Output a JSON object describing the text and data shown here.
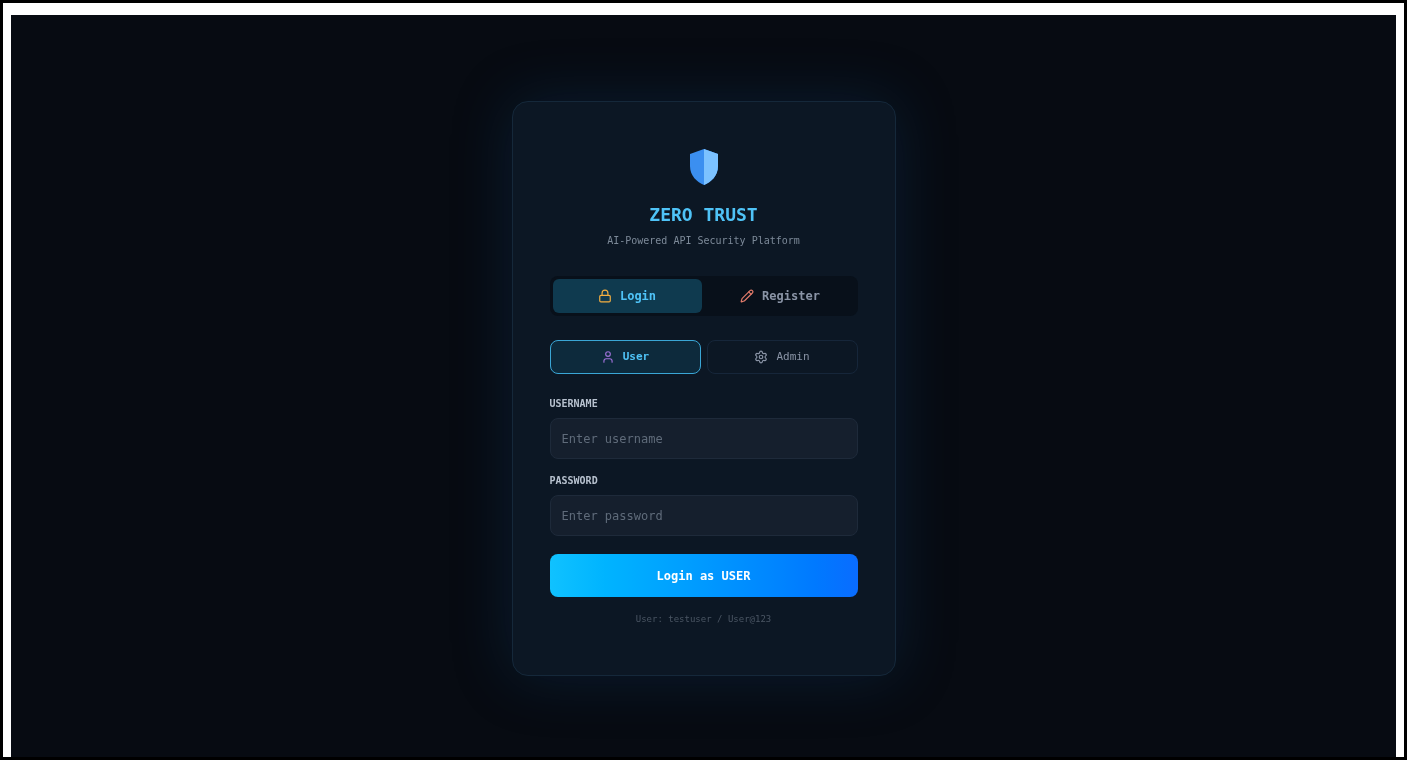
{
  "brand": {
    "title": "ZERO TRUST",
    "subtitle": "AI-Powered API Security Platform"
  },
  "mode_tabs": [
    {
      "kind": "lock",
      "label": "Login",
      "selected": true
    },
    {
      "kind": "pencil",
      "label": "Register",
      "selected": false
    }
  ],
  "role_tabs": [
    {
      "kind": "user",
      "label": "User",
      "selected": true
    },
    {
      "kind": "gear",
      "label": "Admin",
      "selected": false
    }
  ],
  "fields": [
    {
      "label": "USERNAME",
      "placeholder": "Enter username"
    },
    {
      "label": "PASSWORD",
      "placeholder": "Enter password"
    }
  ],
  "submit": {
    "label": "Login as USER"
  },
  "hint": "User: testuser / User@123"
}
